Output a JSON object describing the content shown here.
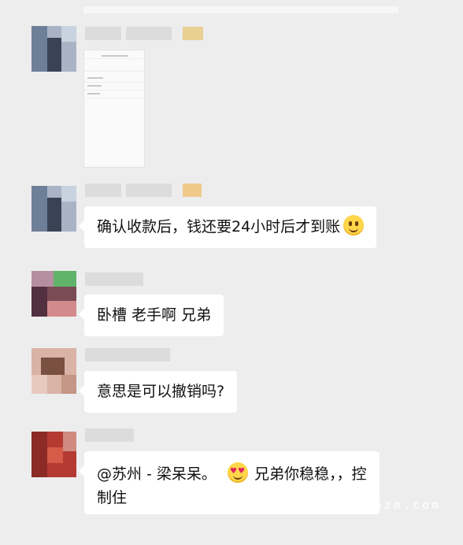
{
  "chat": {
    "messages": [
      {
        "type": "image",
        "content": ""
      },
      {
        "type": "text",
        "text": "确认收款后，钱还要24小时后才到账",
        "emoji": "smile-emoji"
      },
      {
        "type": "text",
        "text": "卧槽 老手啊 兄弟"
      },
      {
        "type": "text",
        "text": "意思是可以撤销吗?"
      },
      {
        "type": "text",
        "text_before": "@苏州 - 梁呆呆。",
        "emoji": "heart-eyes-emoji",
        "text_after": "兄弟你稳稳，，控",
        "text_line2": "制住"
      }
    ]
  },
  "watermark": "www.sxxdozm.com",
  "colors": {
    "background": "#ededed",
    "bubble": "#ffffff"
  }
}
